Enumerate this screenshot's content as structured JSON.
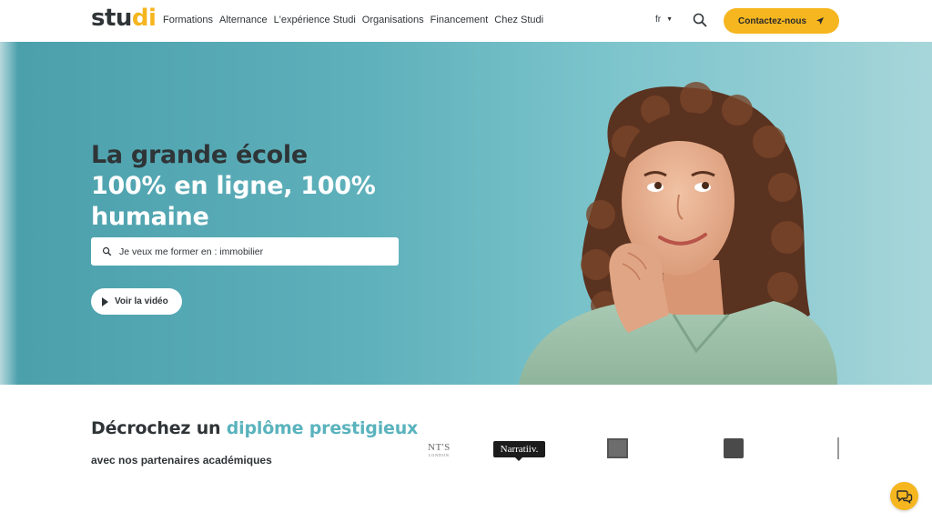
{
  "header": {
    "logo": {
      "part1": "stu",
      "part2": "di"
    },
    "nav": [
      "Formations",
      "Alternance",
      "L'expérience Studi",
      "Organisations",
      "Financement",
      "Chez Studi"
    ],
    "lang": "fr",
    "cta_label": "Contactez-nous"
  },
  "hero": {
    "title_line1": "La grande école",
    "title_line2": "100% en ligne, 100%",
    "title_line3": "humaine",
    "search_text": "Je veux me former en : immobilier",
    "video_label": "Voir la vidéo"
  },
  "partners": {
    "title_part1": "Décrochez un ",
    "title_highlight": "diplôme prestigieux",
    "subtitle": "avec nos partenaires académiques",
    "logo1_text": "NT'S",
    "logo1_sub": "LONDON",
    "logo2_text": "Narratiiv."
  },
  "colors": {
    "accent_yellow": "#f6b61f",
    "hero_teal": "#5fb1bb",
    "highlight_teal": "#5ab3bd",
    "text_dark": "#2f3437"
  },
  "icons": {
    "search": "search-icon",
    "send": "paper-plane-icon",
    "play": "play-icon",
    "chat": "chat-bubbles-icon"
  }
}
